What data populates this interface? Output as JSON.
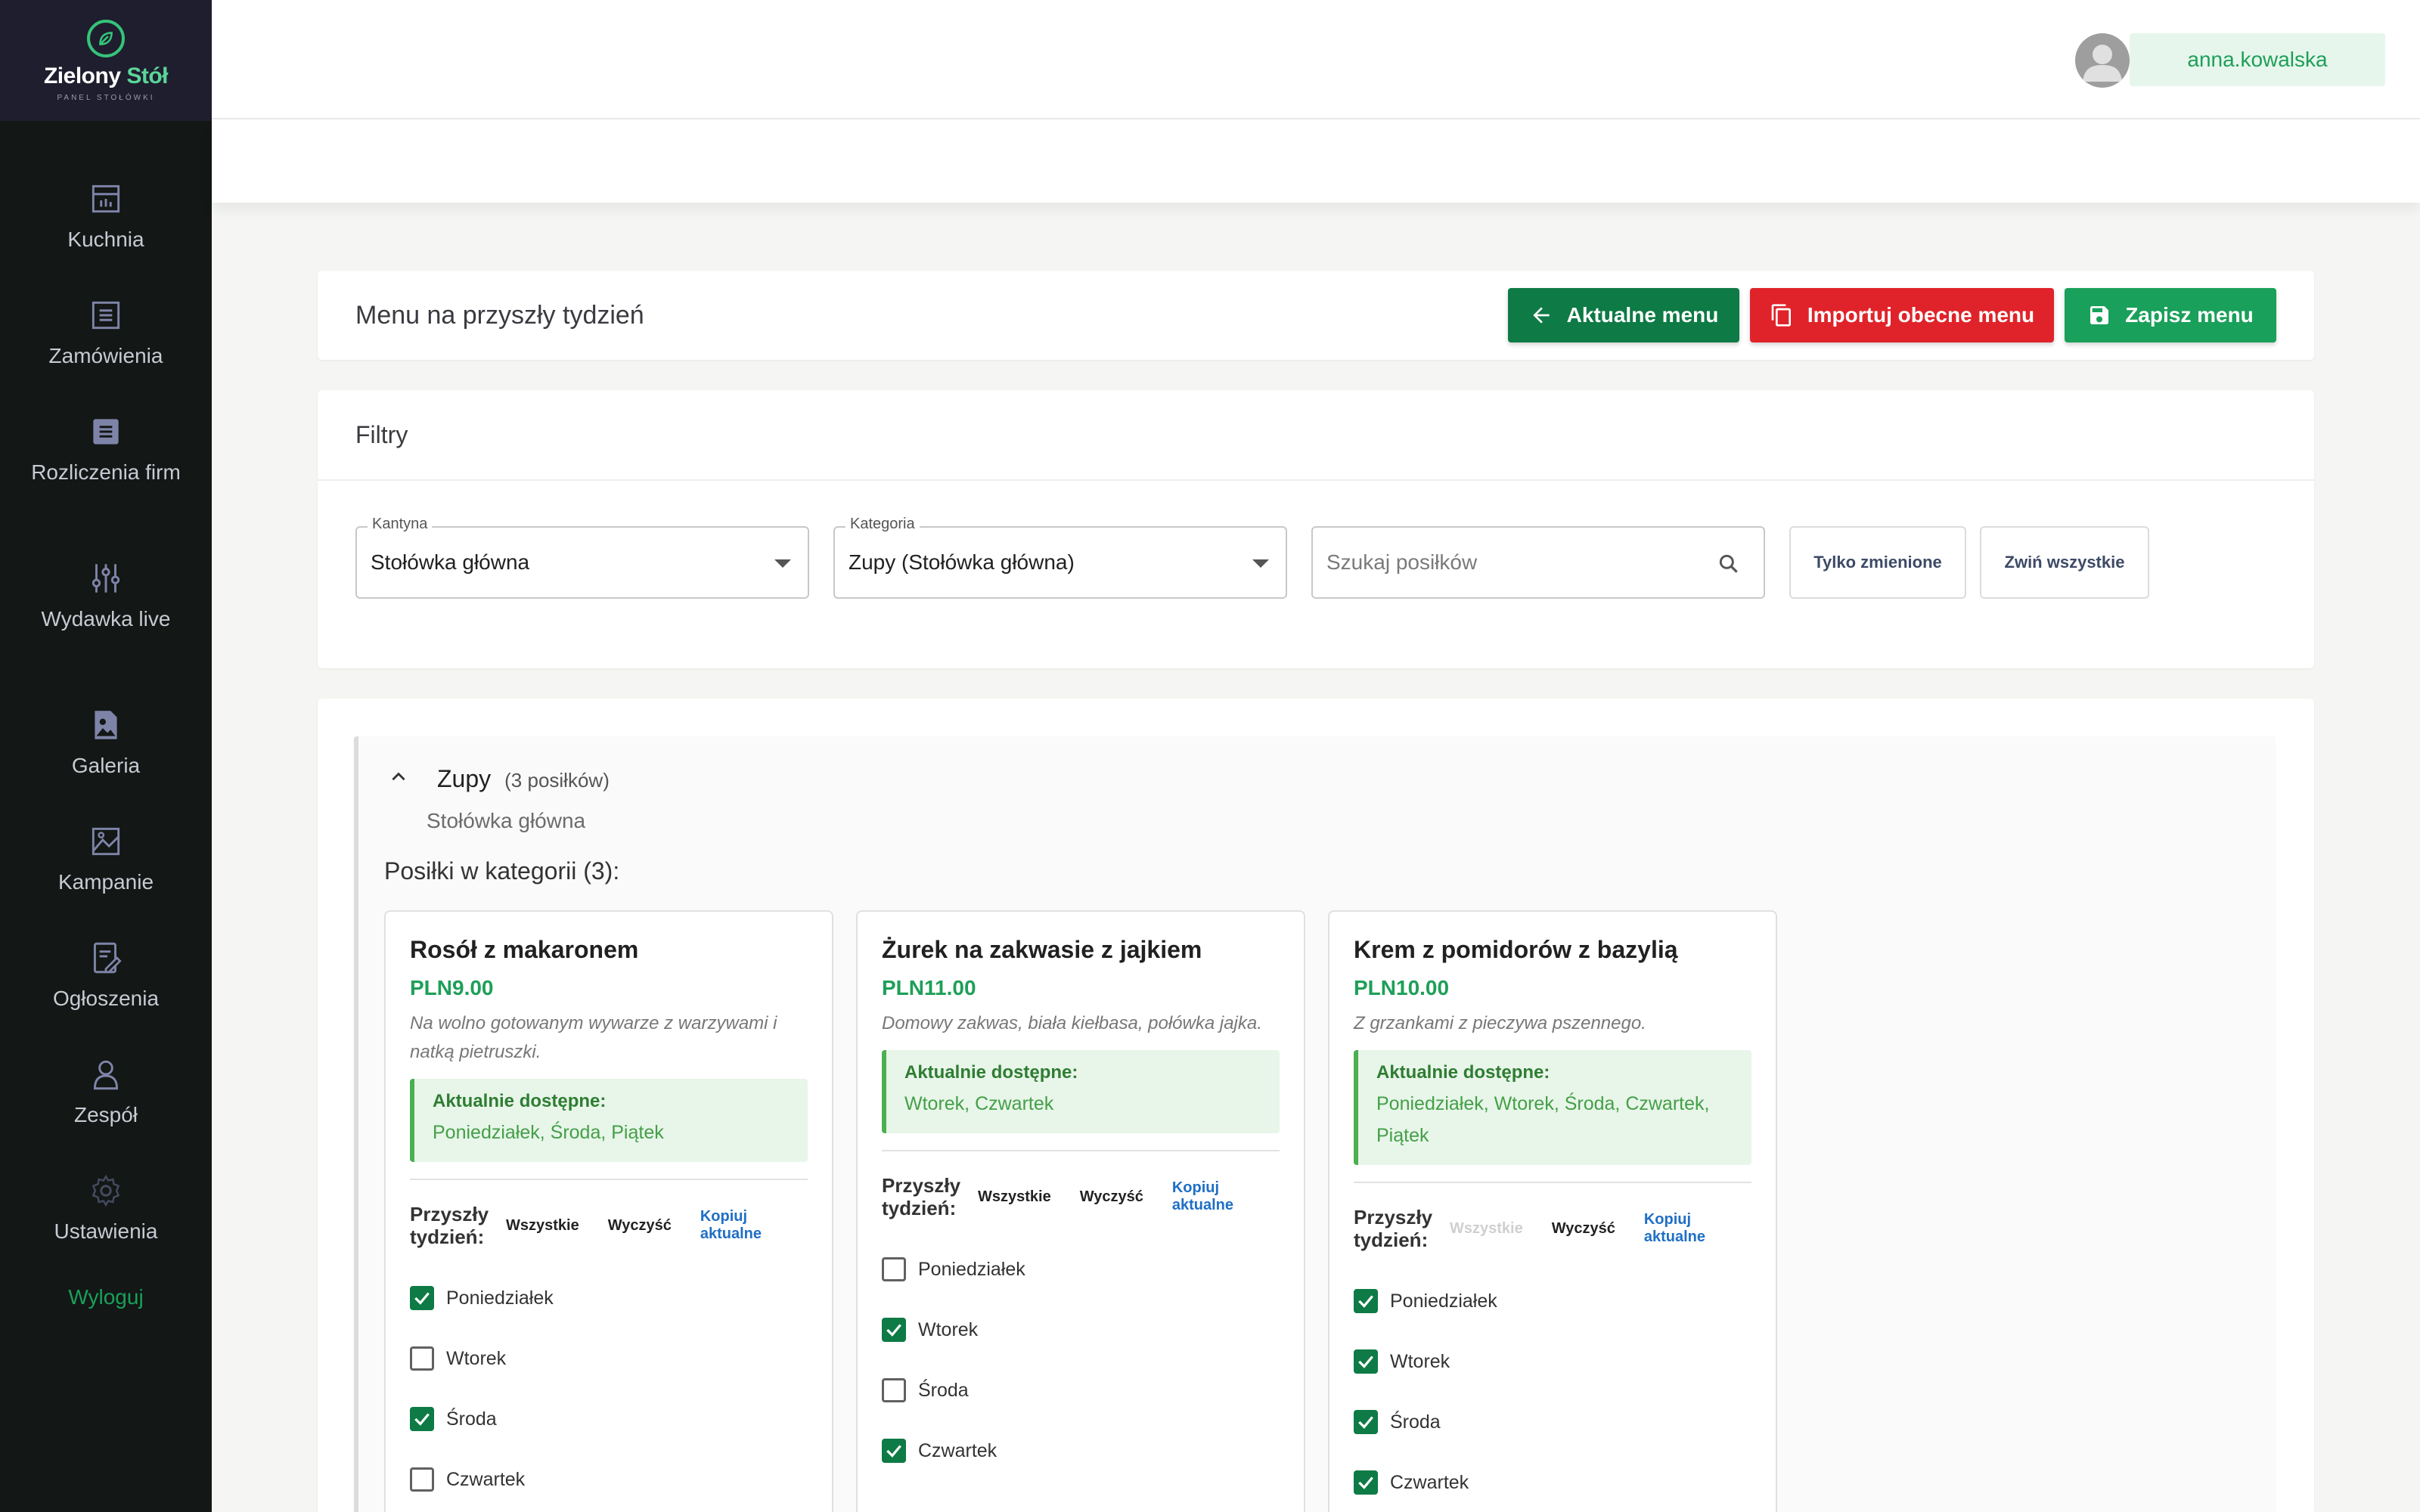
{
  "brand": {
    "name_main": "Zielony ",
    "name_accent": "Stół",
    "subtitle": "PANEL STOŁÓWKI",
    "accent_color": "#35c47a"
  },
  "sidebar": {
    "items": [
      {
        "label": "Kuchnia",
        "icon": "kitchen-icon"
      },
      {
        "label": "Zamówienia",
        "icon": "list-icon"
      },
      {
        "label": "Rozliczenia firm",
        "icon": "billing-icon"
      },
      {
        "label": "Wydawka live",
        "icon": "sliders-icon"
      },
      {
        "label": "Galeria",
        "icon": "image-icon"
      },
      {
        "label": "Kampanie",
        "icon": "picture-icon"
      },
      {
        "label": "Ogłoszenia",
        "icon": "edit-note-icon"
      },
      {
        "label": "Zespół",
        "icon": "user-icon"
      },
      {
        "label": "Ustawienia",
        "icon": "gear-icon"
      }
    ],
    "logout": "Wyloguj"
  },
  "header": {
    "username": "anna.kowalska"
  },
  "page": {
    "title": "Menu na przyszły tydzień",
    "btn_current": "Aktualne menu",
    "btn_import": "Importuj obecne menu",
    "btn_save": "Zapisz menu"
  },
  "filters": {
    "title": "Filtry",
    "canteen_label": "Kantyna",
    "canteen_value": "Stołówka główna",
    "category_label": "Kategoria",
    "category_value": "Zupy (Stołówka główna)",
    "search_placeholder": "Szukaj posiłków",
    "only_changed": "Tylko zmienione",
    "collapse_all": "Zwiń wszystkie"
  },
  "category": {
    "name": "Zupy",
    "count": "(3 posiłków)",
    "canteen": "Stołówka główna",
    "meals_title": "Posiłki w kategorii (3):",
    "avail_title": "Aktualnie dostępne:",
    "next_week": "Przyszły tydzień:",
    "all": "Wszystkie",
    "clear": "Wyczyść",
    "copy": "Kopiuj aktualne",
    "meals": [
      {
        "name": "Rosół z makaronem",
        "price": "PLN9.00",
        "desc": "Na wolno gotowanym wywarze z warzywami i natką pietruszki.",
        "available": "Poniedziałek, Środa, Piątek",
        "days": [
          {
            "label": "Poniedziałek",
            "checked": true
          },
          {
            "label": "Wtorek",
            "checked": false
          },
          {
            "label": "Środa",
            "checked": true
          },
          {
            "label": "Czwartek",
            "checked": false
          }
        ]
      },
      {
        "name": "Żurek na zakwasie z jajkiem",
        "price": "PLN11.00",
        "desc": "Domowy zakwas, biała kiełbasa, połówka jajka.",
        "available": "Wtorek, Czwartek",
        "days": [
          {
            "label": "Poniedziałek",
            "checked": false
          },
          {
            "label": "Wtorek",
            "checked": true
          },
          {
            "label": "Środa",
            "checked": false
          },
          {
            "label": "Czwartek",
            "checked": true
          }
        ]
      },
      {
        "name": "Krem z pomidorów z bazylią",
        "price": "PLN10.00",
        "desc": "Z grzankami z pieczywa pszennego.",
        "available": "Poniedziałek, Wtorek, Środa, Czwartek, Piątek",
        "days": [
          {
            "label": "Poniedziałek",
            "checked": true
          },
          {
            "label": "Wtorek",
            "checked": true
          },
          {
            "label": "Środa",
            "checked": true
          },
          {
            "label": "Czwartek",
            "checked": true
          }
        ]
      }
    ]
  }
}
